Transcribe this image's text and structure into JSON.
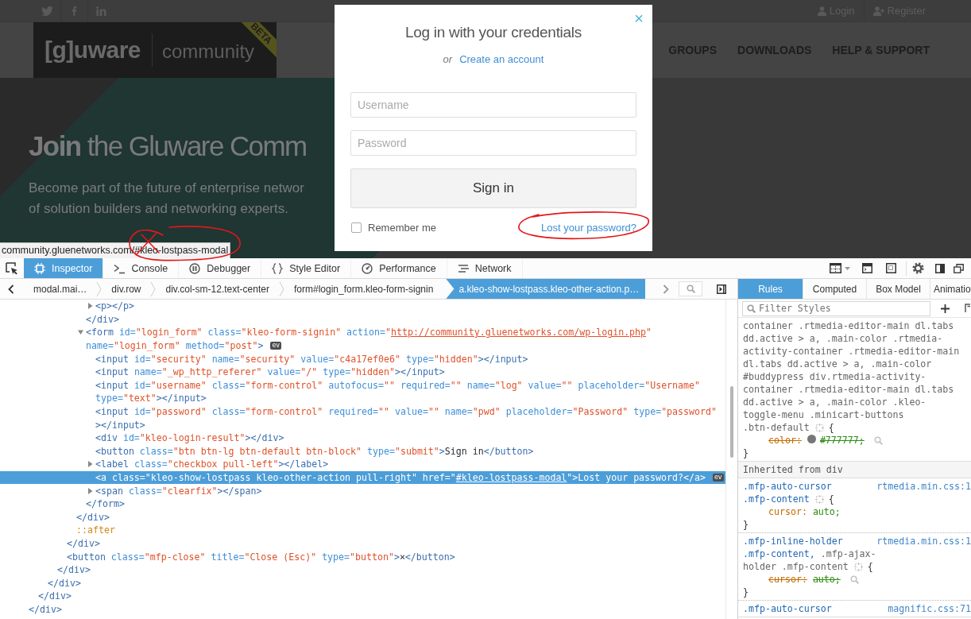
{
  "website": {
    "account_links": [
      {
        "kind": "login",
        "label": "Login"
      },
      {
        "kind": "register",
        "label": "Register"
      }
    ],
    "logo": {
      "wordmark": "[g]uware",
      "product": "community",
      "ribbon": "BETA"
    },
    "nav_items": [
      {
        "label": "GROUPS"
      },
      {
        "label": "DOWNLOADS"
      },
      {
        "label": "HELP & SUPPORT"
      }
    ],
    "hero": {
      "headline": "**Join** the Gluware Comm",
      "subtitle_lines": [
        "Become part of the future of enterprise networ",
        "of solution builders and networking experts."
      ]
    },
    "status_url": "community.gluenetworks.com/#kleo-lostpass-modal"
  },
  "login_modal": {
    "close": "×",
    "title": "Log in with your credentials",
    "alt_prefix": "or",
    "create_account": "Create an account",
    "fields": [
      {
        "placeholder": "Username"
      },
      {
        "placeholder": "Password"
      }
    ],
    "submit": "Sign in",
    "remember": {
      "label": "Remember me",
      "checked": false
    },
    "lost_password": "Lost your password?"
  },
  "devtools": {
    "toolbar_tabs": [
      {
        "kind": "inspector",
        "label": "Inspector",
        "selected": true
      },
      {
        "kind": "console",
        "label": "Console",
        "selected": false
      },
      {
        "kind": "debugger",
        "label": "Debugger",
        "selected": false
      },
      {
        "kind": "style_editor",
        "label": "Style Editor",
        "selected": false
      },
      {
        "kind": "performance",
        "label": "Performance",
        "selected": false
      },
      {
        "kind": "network",
        "label": "Network",
        "selected": false
      }
    ],
    "breadcrumbs": [
      {
        "label": "modal.mai…",
        "selected": false
      },
      {
        "label": "div.row",
        "selected": false
      },
      {
        "label": "div.col-sm-12.text-center",
        "selected": false
      },
      {
        "label": "form#login_form.kleo-form-signin",
        "selected": false
      },
      {
        "label": "a.kleo-show-lostpass.kleo-other-action.p…",
        "selected": true
      }
    ],
    "markup_tree": [
      {
        "kind": "element",
        "selected": false,
        "children": [
          {
            "kind": "element",
            "selected": false,
            "children": [
              {
                "kind": "element",
                "selected": false,
                "children": [
                  {
                    "kind": "element",
                    "selected": false,
                    "children": [
                      {
                        "kind": "element",
                        "selected": false,
                        "children": [
                          {
                            "kind": "element",
                            "selected": false,
                            "children": [
                              {
                                "kind": "element",
                                "selected": false,
                                "children": [
                                  {
                                    "kind": "element",
                                    "selected": false,
                                    "expanded": false,
                                    "tag_lines": [
                                      [
                                        "<p></p>"
                                      ]
                                    ]
                                  }
                                ],
                                "closing": [
                                  "</div>"
                                ]
                              },
                              {
                                "kind": "element",
                                "selected": false,
                                "expanded": true,
                                "event_badge": "ev",
                                "tag_lines": [
                                  [
                                    "<form id=\"login_form\" class=\"kleo-form-signin\" action=\"",
                                    {
                                      "link": "http://community.gluenetworks.com/wp-login.php"
                                    },
                                    "\""
                                  ],
                                  [
                                    "name=\"login_form\" method=\"post\">"
                                  ]
                                ],
                                "children": [
                                  {
                                    "kind": "element",
                                    "selected": false,
                                    "tag_lines": [
                                      [
                                        "<input id=\"security\" name=\"security\" value=\"c4a17ef0e6\" type=\"hidden\"></input>"
                                      ]
                                    ]
                                  },
                                  {
                                    "kind": "element",
                                    "selected": false,
                                    "tag_lines": [
                                      [
                                        "<input name=\"_wp_http_referer\" value=\"/\" type=\"hidden\"></input>"
                                      ]
                                    ]
                                  },
                                  {
                                    "kind": "element",
                                    "selected": false,
                                    "tag_lines": [
                                      [
                                        "<input id=\"username\" class=\"form-control\" autofocus=\"\" required=\"\" name=\"log\" value=\"\" placeholder=\"Username\""
                                      ],
                                      [
                                        "type=\"text\"></input>"
                                      ]
                                    ]
                                  },
                                  {
                                    "kind": "element",
                                    "selected": false,
                                    "tag_lines": [
                                      [
                                        "<input id=\"password\" class=\"form-control\" required=\"\" value=\"\" name=\"pwd\" placeholder=\"Password\" type=\"password\""
                                      ],
                                      [
                                        "></input>"
                                      ]
                                    ]
                                  },
                                  {
                                    "kind": "element",
                                    "selected": false,
                                    "tag_lines": [
                                      [
                                        "<div id=\"kleo-login-result\"></div>"
                                      ]
                                    ]
                                  },
                                  {
                                    "kind": "element",
                                    "selected": false,
                                    "tag_lines": [
                                      [
                                        "<button class=\"btn btn-lg btn-default btn-block\" type=\"submit\">Sign in</button>"
                                      ]
                                    ]
                                  },
                                  {
                                    "kind": "element",
                                    "selected": false,
                                    "expanded": false,
                                    "tag_lines": [
                                      [
                                        "<label class=\"checkbox pull-left\"></label>"
                                      ]
                                    ]
                                  },
                                  {
                                    "kind": "element",
                                    "selected": true,
                                    "event_badge": "ev",
                                    "tag_lines": [
                                      [
                                        "<a class=\"kleo-show-lostpass kleo-other-action pull-right\" href=\"",
                                        {
                                          "link": "#kleo-lostpass-modal"
                                        },
                                        "\">Lost your password?</a>"
                                      ]
                                    ]
                                  },
                                  {
                                    "kind": "element",
                                    "selected": false,
                                    "expanded": false,
                                    "tag_lines": [
                                      [
                                        "<span class=\"clearfix\"></span>"
                                      ]
                                    ]
                                  }
                                ],
                                "closing": [
                                  "</form>"
                                ]
                              }
                            ],
                            "closing": [
                              "</div>"
                            ]
                          },
                          {
                            "kind": "pseudo",
                            "selected": false,
                            "tag_lines": [
                              [
                                "::after"
                              ]
                            ]
                          }
                        ],
                        "closing": [
                          "</div>"
                        ]
                      },
                      {
                        "kind": "element",
                        "selected": false,
                        "tag_lines": [
                          [
                            "<button class=\"mfp-close\" title=\"Close (Esc)\" type=\"button\">×</button>"
                          ]
                        ]
                      }
                    ],
                    "closing": [
                      "</div>"
                    ]
                  }
                ],
                "closing": [
                  "</div>"
                ]
              }
            ],
            "closing": [
              "</div>"
            ]
          }
        ],
        "closing": [
          "</div>"
        ]
      }
    ],
    "sidebar_tabs": [
      {
        "label": "Rules",
        "selected": true
      },
      {
        "label": "Computed",
        "selected": false
      },
      {
        "label": "Box Model",
        "selected": false
      },
      {
        "label": "Animatio",
        "selected": false
      }
    ],
    "filter": {
      "placeholder": "Filter Styles"
    },
    "rules": [
      {
        "kind": "rule",
        "selector_lines": [
          [
            {
              "text": "container .rtmedia-editor-main dl.tabs",
              "matched": false
            }
          ],
          [
            {
              "text": "dd.active > a, .main-color .rtmedia-",
              "matched": false
            }
          ],
          [
            {
              "text": "activity-container .rtmedia-editor-main",
              "matched": false
            }
          ],
          [
            {
              "text": "dl.tabs dd.active > a, .main-color",
              "matched": false
            }
          ],
          [
            {
              "text": "#buddypress div.rtmedia-activity-",
              "matched": false
            }
          ],
          [
            {
              "text": "container .rtmedia-editor-main dl.tabs",
              "matched": false
            }
          ],
          [
            {
              "text": "dd.active > a, .main-color .kleo-",
              "matched": false
            }
          ],
          [
            {
              "text": "toggle-menu .minicart-buttons",
              "matched": false
            }
          ],
          [
            {
              "text": ".btn-default",
              "matched": false
            }
          ]
        ],
        "open_brace": "{",
        "declarations": [
          {
            "property": "color:",
            "value": "#777777;",
            "color": "#777777",
            "overridden": true
          }
        ],
        "close_brace": "}"
      },
      {
        "kind": "inherited_header",
        "label": "Inherited from div"
      },
      {
        "kind": "rule",
        "source": "rtmedia.min.css:1",
        "selector_lines": [
          [
            {
              "text": ".mfp-auto-cursor",
              "matched": true
            }
          ],
          [
            {
              "text": ".mfp-content",
              "matched": true
            }
          ]
        ],
        "open_brace": "{",
        "declarations": [
          {
            "property": "cursor:",
            "value": "auto;",
            "overridden": false
          }
        ],
        "close_brace": "}"
      },
      {
        "kind": "rule",
        "source": "rtmedia.min.css:1",
        "selector_lines": [
          [
            {
              "text": ".mfp-inline-holder",
              "matched": true
            }
          ],
          [
            {
              "text": ".mfp-content,",
              "matched": true
            },
            {
              "text": " .mfp-ajax-",
              "matched": false
            }
          ],
          [
            {
              "text": "holder .mfp-content",
              "matched": false
            }
          ]
        ],
        "open_brace": "{",
        "declarations": [
          {
            "property": "cursor:",
            "value": "auto;",
            "overridden": true
          }
        ],
        "close_brace": "}"
      },
      {
        "kind": "rule",
        "source": "magnific.css:71",
        "selector_lines": [
          [
            {
              "text": ".mfp-auto-cursor",
              "matched": true
            }
          ]
        ]
      }
    ]
  }
}
